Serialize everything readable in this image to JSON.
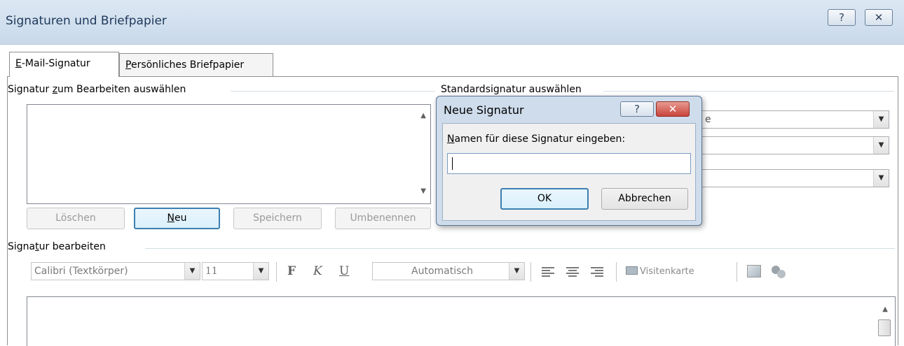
{
  "window": {
    "title": "Signaturen und Briefpapier",
    "help_button": "?",
    "close_button": "✕"
  },
  "tabs": [
    {
      "label_prefix": "",
      "label_underlined": "E",
      "label_suffix": "-Mail-Signatur"
    },
    {
      "label_prefix": "",
      "label_underlined": "P",
      "label_suffix": "ersönliches Briefpapier"
    }
  ],
  "select_signature": {
    "label_prefix": "Signatur ",
    "label_underlined": "z",
    "label_suffix": "um Bearbeiten auswählen",
    "buttons": {
      "delete": "Löschen",
      "new_underlined": "N",
      "new_suffix": "eu",
      "save": "Speichern",
      "rename": "Umbenennen"
    }
  },
  "default_signature": {
    "label": "Standardsignatur auswählen",
    "partial_text": "e"
  },
  "edit_signature": {
    "label_prefix": "Signa",
    "label_underlined": "t",
    "label_suffix": "ur bearbeiten",
    "font": "Calibri (Textkörper)",
    "size": "11",
    "bold": "F",
    "italic": "K",
    "underline": "U",
    "color": "Automatisch",
    "business_card": "Visitenkarte"
  },
  "dialog": {
    "title": "Neue Signatur",
    "help_button": "?",
    "close_button": "✕",
    "label_underlined": "N",
    "label_suffix": "amen für diese Signatur eingeben:",
    "input_value": "",
    "ok": "OK",
    "cancel": "Abbrechen"
  },
  "colors": {
    "titlebar": "#c9d9ea",
    "dialog_close": "#c8433a",
    "focus_border": "#3c7fb1"
  }
}
